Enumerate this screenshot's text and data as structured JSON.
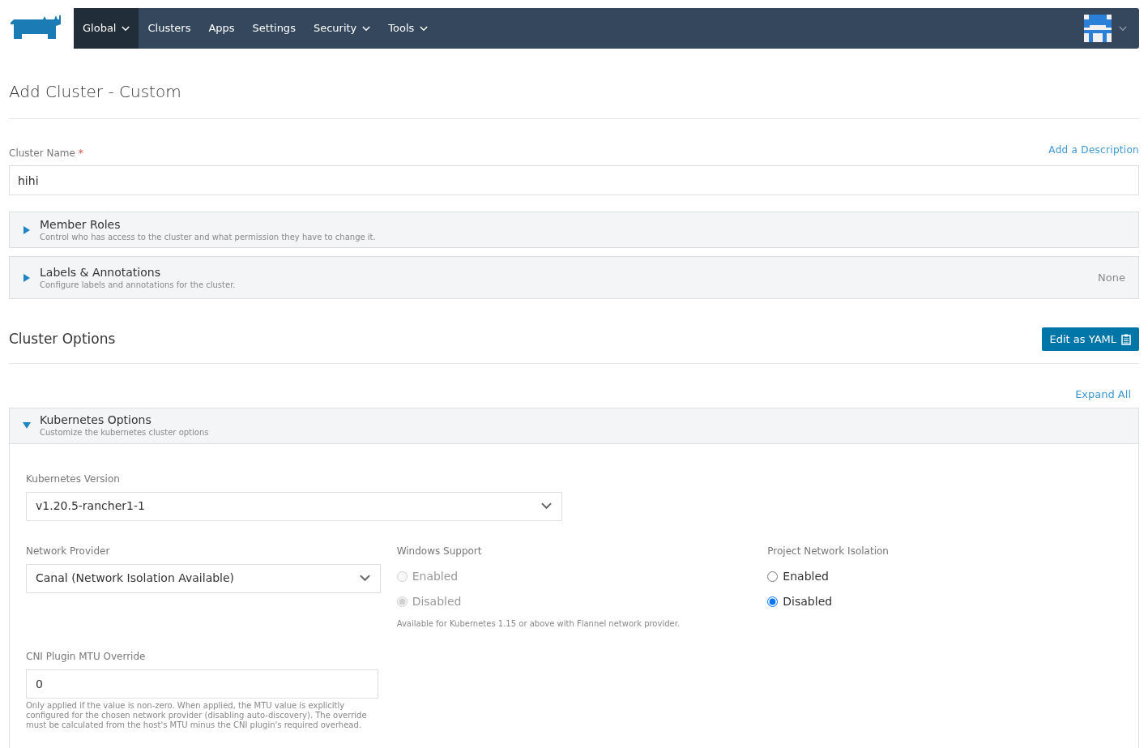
{
  "nav": {
    "items": [
      {
        "label": "Global",
        "dropdown": true,
        "selected": true
      },
      {
        "label": "Clusters",
        "dropdown": false,
        "selected": false
      },
      {
        "label": "Apps",
        "dropdown": false,
        "selected": false
      },
      {
        "label": "Settings",
        "dropdown": false,
        "selected": false
      },
      {
        "label": "Security",
        "dropdown": true,
        "selected": false
      },
      {
        "label": "Tools",
        "dropdown": true,
        "selected": false
      }
    ]
  },
  "page_title": "Add Cluster - Custom",
  "cluster_name": {
    "label": "Cluster Name",
    "required_mark": "*",
    "value": "hihi",
    "add_description": "Add a Description"
  },
  "sections": [
    {
      "title": "Member Roles",
      "subtitle": "Control who has access to the cluster and what permission they have to change it.",
      "expanded": false
    },
    {
      "title": "Labels & Annotations",
      "subtitle": "Configure labels and annotations for the cluster.",
      "expanded": false,
      "summary": "None"
    }
  ],
  "cluster_options": {
    "title": "Cluster Options",
    "edit_yaml": "Edit as YAML",
    "expand_all": "Expand All"
  },
  "kubernetes_options": {
    "title": "Kubernetes Options",
    "subtitle": "Customize the kubernetes cluster options",
    "expanded": true,
    "version": {
      "label": "Kubernetes Version",
      "value": "v1.20.5-rancher1-1"
    },
    "network_provider": {
      "label": "Network Provider",
      "value": "Canal (Network Isolation Available)"
    },
    "windows_support": {
      "label": "Windows Support",
      "options": [
        {
          "label": "Enabled",
          "selected": false,
          "disabled": true
        },
        {
          "label": "Disabled",
          "selected": true,
          "disabled": true
        }
      ],
      "help": "Available for Kubernetes 1.15 or above with Flannel network provider."
    },
    "project_network_isolation": {
      "label": "Project Network Isolation",
      "options": [
        {
          "label": "Enabled",
          "selected": false,
          "disabled": false
        },
        {
          "label": "Disabled",
          "selected": true,
          "disabled": false
        }
      ]
    },
    "mtu": {
      "label": "CNI Plugin MTU Override",
      "value": "0",
      "help": "Only applied if the value is non-zero. When applied, the MTU value is explicitly configured for the chosen network provider (disabling auto-discovery). The override must be calculated from the host's MTU minus the CNI plugin's required overhead."
    }
  }
}
